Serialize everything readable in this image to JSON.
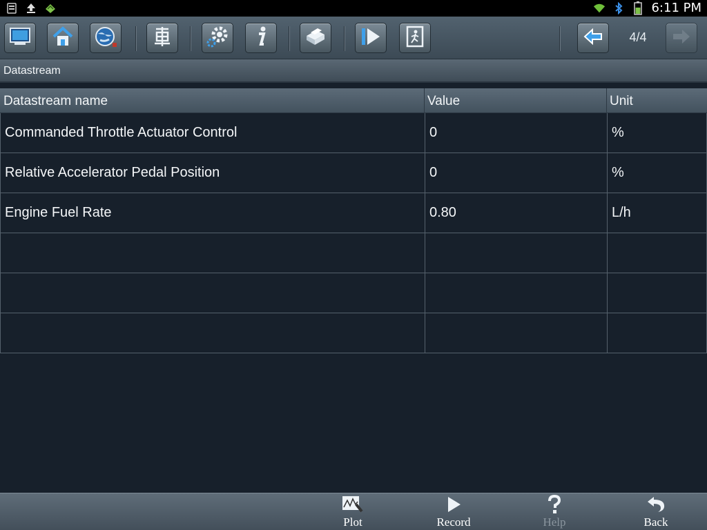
{
  "status_bar": {
    "time": "6:11 PM",
    "left_icons": [
      "notification-icon",
      "upload-icon",
      "app-icon"
    ],
    "right_icons": [
      "wifi-icon",
      "bluetooth-icon",
      "battery-icon"
    ]
  },
  "toolbar": {
    "buttons": [
      "screen-icon",
      "home-icon",
      "globe-icon",
      "vehicle-icon",
      "settings-icon",
      "info-icon",
      "print-icon",
      "play-icon",
      "exit-icon"
    ],
    "page_indicator": "4/4"
  },
  "section": {
    "title": "Datastream"
  },
  "table": {
    "columns": [
      "Datastream name",
      "Value",
      "Unit"
    ],
    "rows": [
      {
        "name": "Commanded Throttle Actuator Control",
        "value": "0",
        "unit": "%"
      },
      {
        "name": "Relative Accelerator Pedal Position",
        "value": "0",
        "unit": "%"
      },
      {
        "name": "Engine Fuel Rate",
        "value": "0.80",
        "unit": "L/h"
      },
      {
        "name": "",
        "value": "",
        "unit": ""
      },
      {
        "name": "",
        "value": "",
        "unit": ""
      },
      {
        "name": "",
        "value": "",
        "unit": ""
      }
    ]
  },
  "bottom_bar": {
    "plot": "Plot",
    "record": "Record",
    "help": "Help",
    "back": "Back"
  }
}
